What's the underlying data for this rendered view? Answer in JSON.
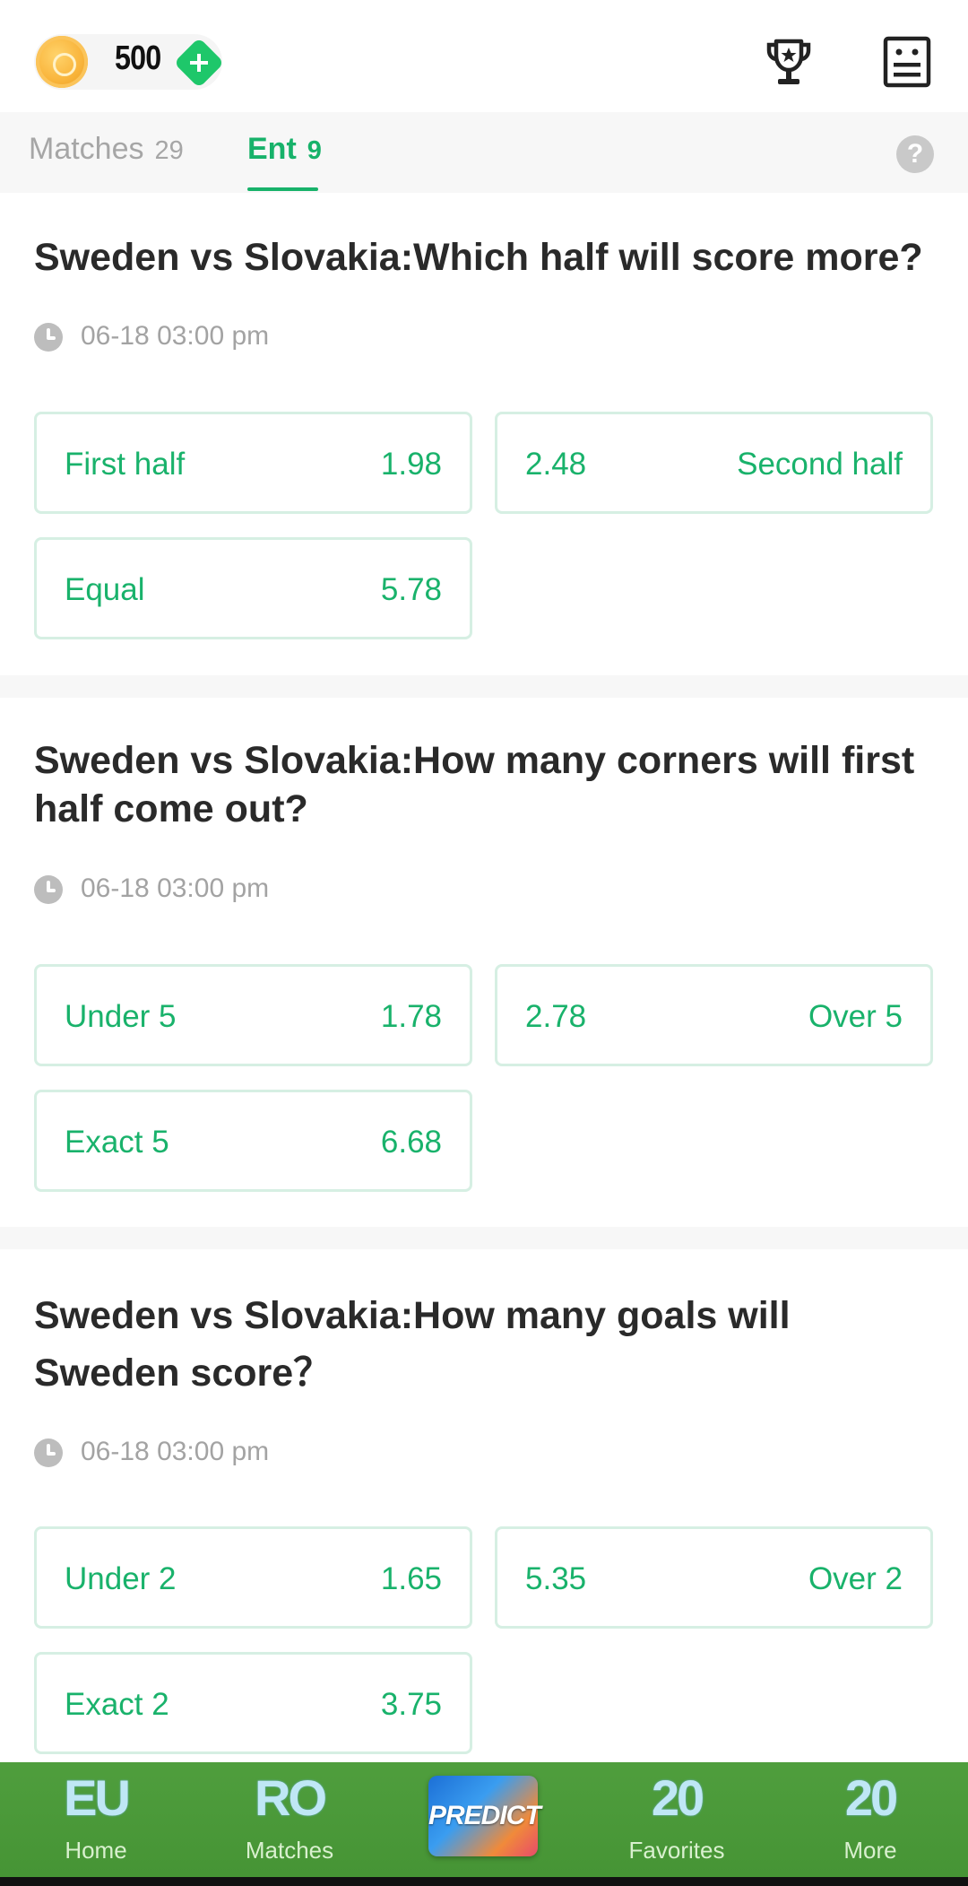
{
  "header": {
    "coin_balance": "500",
    "icons": [
      "coin-icon",
      "add-icon",
      "trophy-icon",
      "records-icon"
    ]
  },
  "tabs": [
    {
      "label": "Matches",
      "count": "29",
      "active": false
    },
    {
      "label": "Ent",
      "count": "9",
      "active": true
    }
  ],
  "help_symbol": "?",
  "questions": [
    {
      "title": "Sweden vs Slovakia:Which half will score more?",
      "time": "06-18 03:00 pm",
      "options": [
        {
          "label": "First half",
          "odds": "1.98"
        },
        {
          "label": "Second half",
          "odds": "2.48"
        },
        {
          "label": "Equal",
          "odds": "5.78"
        }
      ]
    },
    {
      "title": "Sweden vs Slovakia:How many corners will first half come out?",
      "time": "06-18 03:00 pm",
      "options": [
        {
          "label": "Under 5",
          "odds": "1.78"
        },
        {
          "label": "Over 5",
          "odds": "2.78"
        },
        {
          "label": "Exact 5",
          "odds": "6.68"
        }
      ]
    },
    {
      "title": "Sweden vs Slovakia:How many goals will Sweden score？",
      "time": "06-18 03:00 pm",
      "options": [
        {
          "label": "Under 2",
          "odds": "1.65"
        },
        {
          "label": "Over 2",
          "odds": "5.35"
        },
        {
          "label": "Exact 2",
          "odds": "3.75"
        }
      ]
    }
  ],
  "bottom_nav": [
    {
      "label": "Home",
      "art": "EU"
    },
    {
      "label": "Matches",
      "art": "RO"
    },
    {
      "label": "",
      "art": "PREDICT"
    },
    {
      "label": "Favorites",
      "art": "20"
    },
    {
      "label": "More",
      "art": "20"
    }
  ],
  "colors": {
    "accent": "#17b26a",
    "option_border": "#d6efe3",
    "nav_bg": "#4a9839"
  }
}
